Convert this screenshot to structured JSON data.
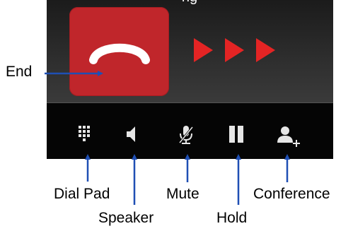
{
  "header": {
    "cut_text": "ng"
  },
  "call_controls": {
    "end_label": "End",
    "arrow_color": "#e42424",
    "end_button_color": "#c0262b",
    "icons": {
      "end": "phone-hangup-icon",
      "dial_pad": "dial-pad-icon",
      "speaker": "speaker-icon",
      "mute": "mute-microphone-icon",
      "hold": "pause-icon",
      "conference": "add-person-icon"
    }
  },
  "toolbar": {
    "items": [
      {
        "label": "Dial Pad"
      },
      {
        "label": "Speaker"
      },
      {
        "label": "Mute"
      },
      {
        "label": "Hold"
      },
      {
        "label": "Conference"
      }
    ]
  },
  "annotation": {
    "arrow_color": "#1f4fb4"
  }
}
